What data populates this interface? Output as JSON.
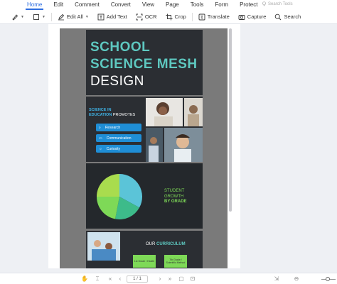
{
  "menubar": {
    "items": [
      "Home",
      "Edit",
      "Comment",
      "Convert",
      "View",
      "Page",
      "Tools",
      "Form",
      "Protect"
    ],
    "search_tools": "Search Tools"
  },
  "toolbar": {
    "edit_all": "Edit All",
    "add_text": "Add Text",
    "ocr": "OCR",
    "crop": "Crop",
    "translate": "Translate",
    "capture": "Capture",
    "search": "Search"
  },
  "document": {
    "slide1": {
      "line1": "SCHOOL",
      "line2": "SCIENCE MESH",
      "line3": "DESIGN"
    },
    "slide2": {
      "subtitle_a": "SCIENCE IN",
      "subtitle_b": "EDUCATION",
      "subtitle_c": "PROMOTES",
      "pills": [
        "Research",
        "Communication",
        "Curiosity"
      ]
    },
    "slide3": {
      "growth_a": "STUDENT",
      "growth_b": "GROWTH",
      "growth_c": "BY GRADE",
      "pie": [
        {
          "value": 33,
          "color": "#5bc4d8"
        },
        {
          "value": 20,
          "color": "#3dbb8a"
        },
        {
          "value": 22,
          "color": "#7ed957"
        },
        {
          "value": 25,
          "color": "#a9dc4e"
        }
      ]
    },
    "slide4": {
      "title_a": "OUR",
      "title_b": "CURRICULUM",
      "box1": "1st Grade / Health",
      "box2": "7th Grade / Scientific Method"
    }
  },
  "bottombar": {
    "page_field": "1 / 1"
  }
}
